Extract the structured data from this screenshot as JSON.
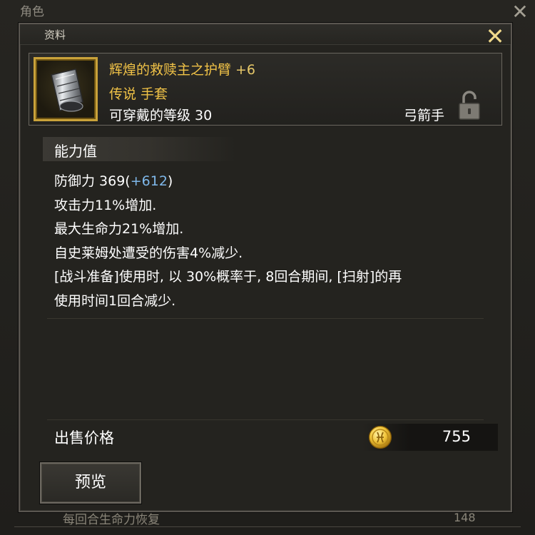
{
  "background_window": {
    "title": "角色",
    "close_glyph": "✕",
    "row_label": "每回合生命力恢复",
    "row_value": "148"
  },
  "popup": {
    "title": "资料",
    "close_glyph": "✕"
  },
  "item": {
    "name": "辉煌的救赎主之护臂",
    "enhancement": "+6",
    "type": "传说 手套",
    "level_requirement": "可穿戴的等级 30",
    "class": "弓箭手",
    "icon": "gauntlet-icon",
    "frame_color": "#c9a23a",
    "name_color": "#f0c247"
  },
  "stats": {
    "header": "能力值",
    "defense_label": "防御力 369(",
    "defense_bonus": "+612",
    "defense_close": ")",
    "lines": [
      "攻击力11%增加.",
      "最大生命力21%增加.",
      "自史莱姆处遭受的伤害4%减少.",
      "[战斗准备]使用时, 以 30%概率于, 8回合期间, [扫射]的再",
      "使用时间1回合减少."
    ],
    "bonus_color": "#7fb8ea"
  },
  "price": {
    "label": "出售价格",
    "value": "755",
    "icon": "gold-coin-icon"
  },
  "buttons": {
    "preview": "预览"
  }
}
